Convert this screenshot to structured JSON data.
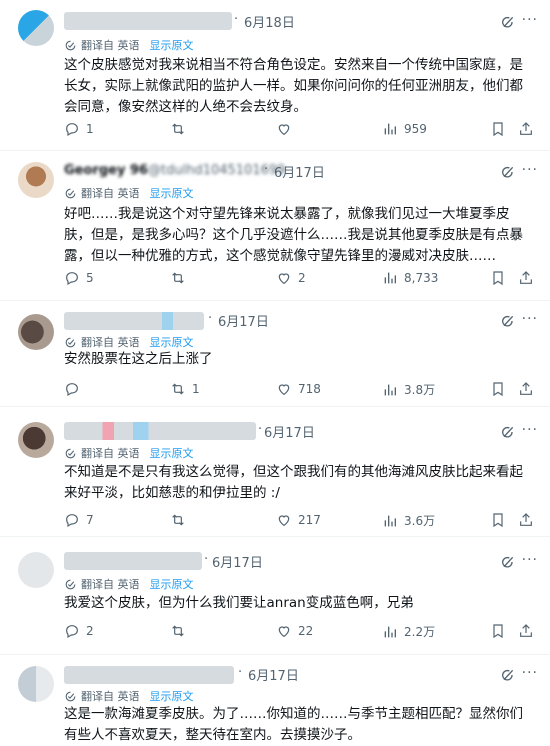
{
  "translate_label": "翻译自 英语",
  "show_original": "显示原文",
  "tweets": [
    {
      "date": "6月18日",
      "text": "这个皮肤感觉对我来说相当不符合角色设定。安然来自一个传统中国家庭，是长女，实际上就像武阳的监护人一样。如果你问问你的任何亚洲朋友，他们都会同意，像安然这样的人绝不会去纹身。",
      "replies": "1",
      "retweets": "",
      "likes": "",
      "views": "959"
    },
    {
      "date": "6月17日",
      "handle": "@tdulhd1045101699",
      "name": "Georgey 96",
      "text": "好吧……我是说这个对守望先锋来说太暴露了，就像我们见过一大堆夏季皮肤，但是，是我多心吗？这个几乎没遮什么……我是说其他夏季皮肤是有点暴露，但以一种优雅的方式，这个感觉就像守望先锋里的漫威对决皮肤……",
      "replies": "5",
      "retweets": "",
      "likes": "2",
      "views": "8,733"
    },
    {
      "date": "6月17日",
      "text": "安然股票在这之后上涨了",
      "replies": "",
      "retweets": "1",
      "likes": "718",
      "views": "3.8万"
    },
    {
      "date": "6月17日",
      "text": "不知道是不是只有我这么觉得，但这个跟我们有的其他海滩风皮肤比起来看起来好平淡，比如慈悲的和伊拉里的 :/",
      "replies": "7",
      "retweets": "",
      "likes": "217",
      "views": "3.6万"
    },
    {
      "date": "6月17日",
      "text": "我爱这个皮肤，但为什么我们要让anran变成蓝色啊，兄弟",
      "replies": "2",
      "retweets": "",
      "likes": "22",
      "views": "2.2万"
    },
    {
      "date": "6月17日",
      "text": "这是一款海滩夏季皮肤。为了……你知道的……与季节主题相匹配？显然你们有些人不喜欢夏天，整天待在室内。去摸摸沙子。",
      "replies": "",
      "retweets": "",
      "likes": "",
      "views": ""
    }
  ],
  "colors": {
    "link": "#1d9bf0",
    "muted": "#536471",
    "text": "#0f1419"
  }
}
